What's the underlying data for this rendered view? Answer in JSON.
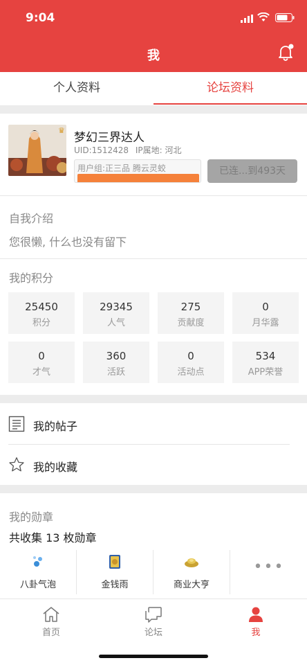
{
  "status_bar": {
    "time": "9:04"
  },
  "header": {
    "title": "我"
  },
  "tabs": [
    {
      "label": "个人资料"
    },
    {
      "label": "论坛资料"
    }
  ],
  "profile": {
    "username": "梦幻三界达人",
    "uid": "UID:1512428",
    "ip_location": "IP属地: 河北",
    "user_group": "用户组:正三品  腾云灵蛟",
    "checkin_label": "已连...到493天"
  },
  "intro": {
    "label": "自我介绍",
    "text": "您很懒, 什么也没有留下"
  },
  "points": {
    "label": "我的积分",
    "items": [
      {
        "value": "25450",
        "name": "积分"
      },
      {
        "value": "29345",
        "name": "人气"
      },
      {
        "value": "275",
        "name": "贡献度"
      },
      {
        "value": "0",
        "name": "月华露"
      },
      {
        "value": "0",
        "name": "才气"
      },
      {
        "value": "360",
        "name": "活跃"
      },
      {
        "value": "0",
        "name": "活动点"
      },
      {
        "value": "534",
        "name": "APP荣誉"
      }
    ]
  },
  "menu": [
    {
      "label": "我的帖子",
      "icon": "document-icon"
    },
    {
      "label": "我的收藏",
      "icon": "star-icon"
    }
  ],
  "medals": {
    "label": "我的勋章",
    "count_text": "共收集 13 枚勋章",
    "items": [
      {
        "name": "八卦气泡",
        "icon": "bubble-medal-icon"
      },
      {
        "name": "金钱雨",
        "icon": "money-rain-medal-icon"
      },
      {
        "name": "商业大亨",
        "icon": "gold-ingot-medal-icon"
      }
    ],
    "more": "•••"
  },
  "tabbar": [
    {
      "label": "首页",
      "icon": "home-icon"
    },
    {
      "label": "论坛",
      "icon": "chat-icon"
    },
    {
      "label": "我",
      "icon": "person-icon"
    }
  ],
  "colors": {
    "accent": "#e64340",
    "checkin_bg": "#a5a5a5",
    "group_bar": "#f5813a"
  }
}
